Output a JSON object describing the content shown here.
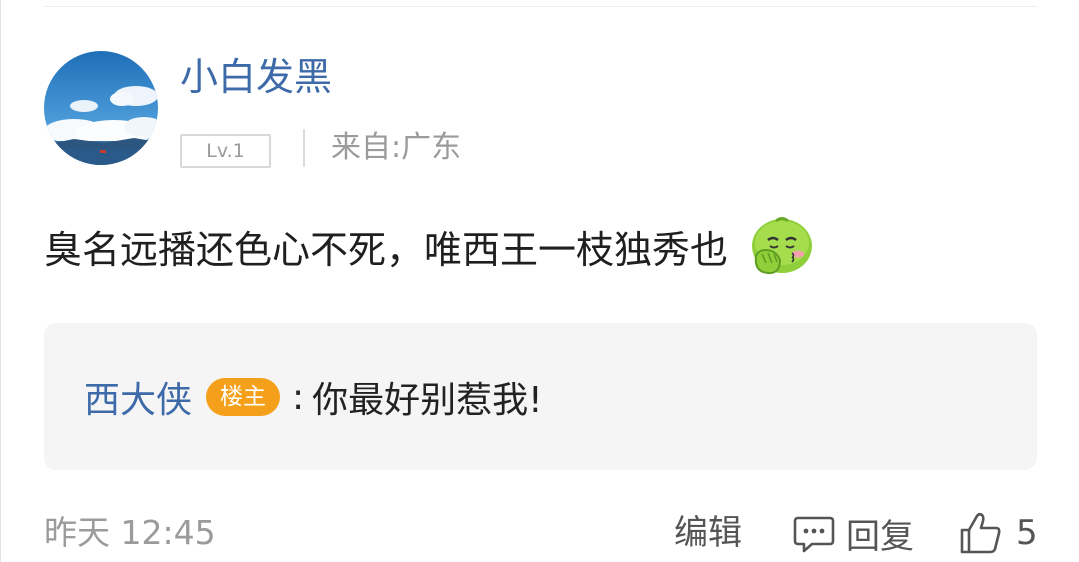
{
  "comment": {
    "user": {
      "name": "小白发黑",
      "level": "Lv.1",
      "location_prefix": "来自:",
      "location": "广东"
    },
    "text": "臭名远播还色心不死，唯西王一枝独秀也",
    "emoji": "shy-blush-sticker",
    "reply": {
      "author": "西大侠",
      "badge": "楼主",
      "separator": ":",
      "text": "你最好别惹我!"
    },
    "footer": {
      "timestamp": "昨天 12:45",
      "edit_label": "编辑",
      "reply_label": "回复",
      "like_count": "5"
    }
  },
  "colors": {
    "username": "#3d6aa8",
    "owner_badge": "#f5a01a",
    "reply_background": "#f5f5f6",
    "muted_text": "#9b9b9b"
  }
}
